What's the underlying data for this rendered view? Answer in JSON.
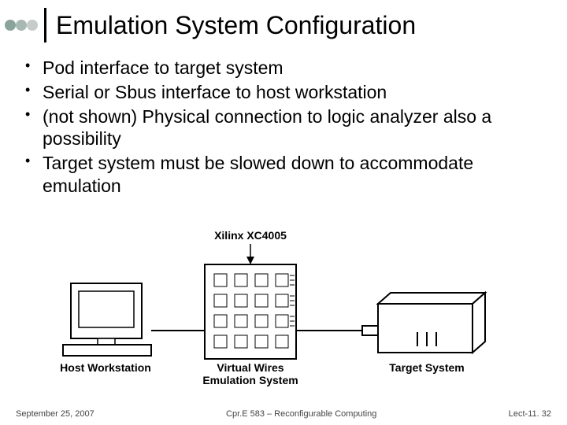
{
  "header": {
    "title": "Emulation System Configuration",
    "dot_colors": [
      "#8aa39b",
      "#a8b8b2",
      "#c6ccc8"
    ]
  },
  "bullets": [
    "Pod interface to target system",
    "Serial or Sbus interface to host workstation",
    "(not shown) Physical connection to logic analyzer also a possibility",
    "Target system must be slowed down to accommodate emulation"
  ],
  "diagram": {
    "top_label": "Xilinx XC4005",
    "host_label": "Host Workstation",
    "emulator_label_line1": "Virtual Wires",
    "emulator_label_line2": "Emulation System",
    "target_label": "Target System"
  },
  "footer": {
    "left": "September 25, 2007",
    "center": "Cpr.E 583 – Reconfigurable Computing",
    "right": "Lect-11. 32"
  }
}
